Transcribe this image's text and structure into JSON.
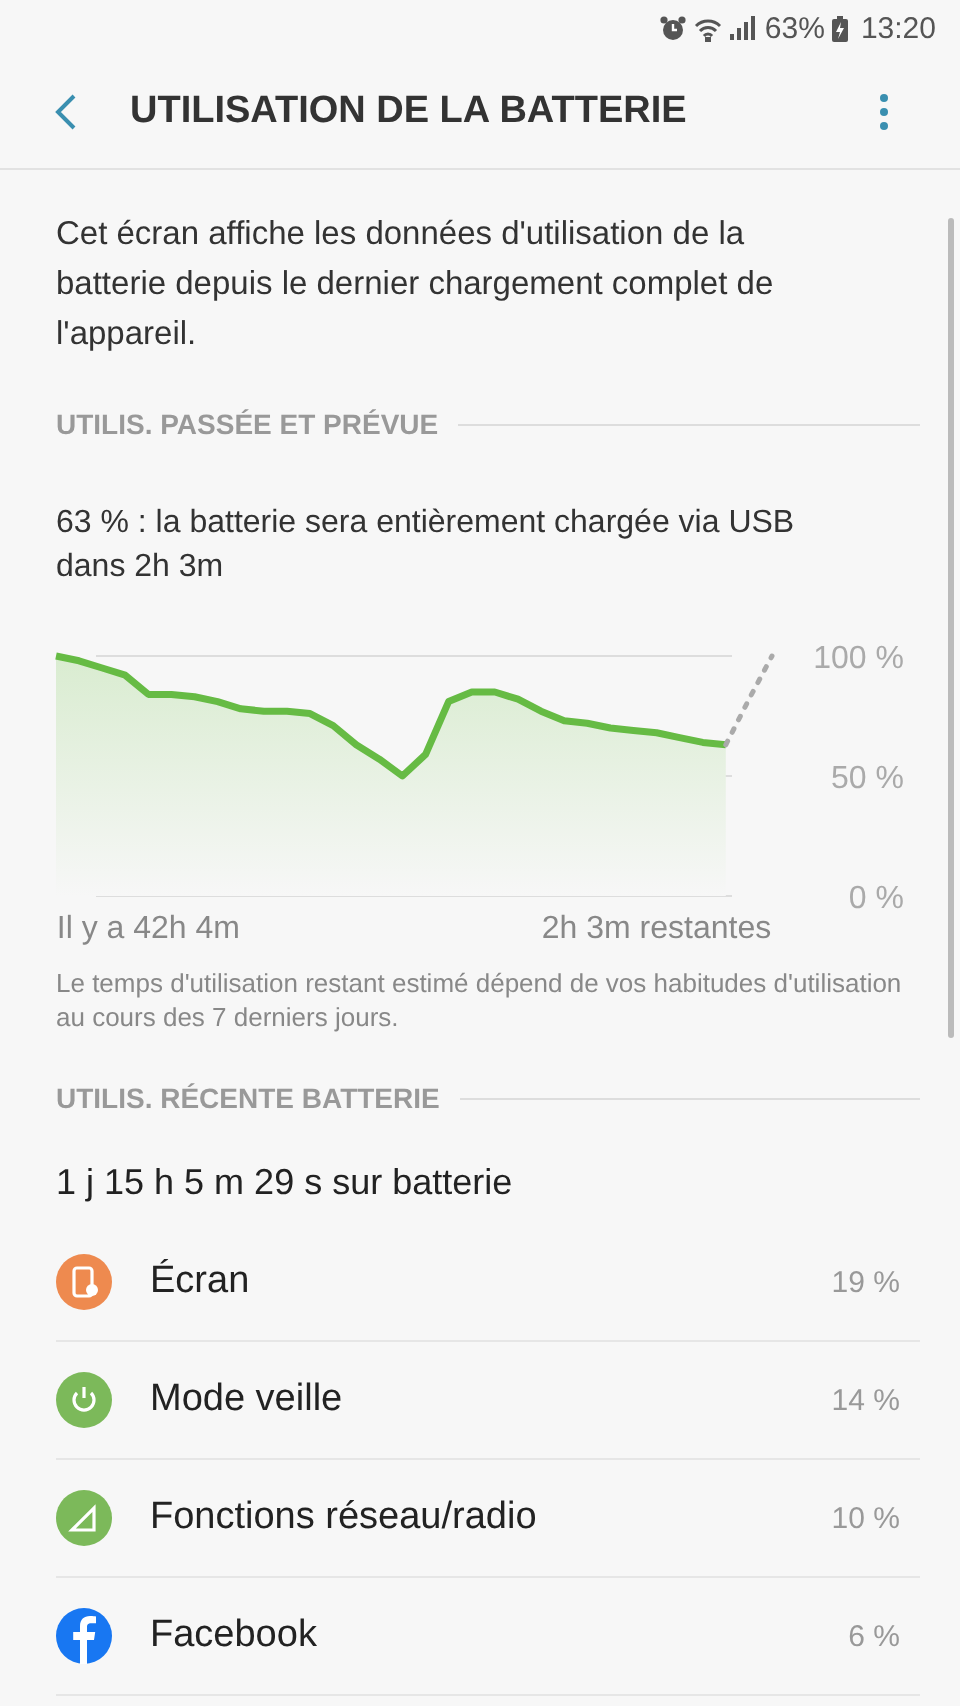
{
  "status_bar": {
    "battery": "63%",
    "time": "13:20"
  },
  "header": {
    "title": "UTILISATION DE LA BATTERIE"
  },
  "intro": "Cet écran affiche les données d'utilisation de la batterie depuis le dernier chargement complet de l'appareil.",
  "past_and_forecast": {
    "heading": "UTILIS. PASSÉE ET PRÉVUE",
    "status": "63 % : la batterie sera entièrement chargée via USB dans 2h 3m",
    "chart_data": {
      "type": "area",
      "categories": [
        null,
        null,
        null,
        null,
        "Il y a 42h 4m",
        null,
        null,
        null,
        null,
        null,
        null,
        null,
        null,
        null,
        null,
        null,
        null,
        null,
        null,
        null,
        null,
        null,
        null,
        null,
        null,
        null,
        "2h 3m restantes",
        null,
        null,
        null,
        null,
        null
      ],
      "ylim": [
        0,
        100
      ],
      "yticks": [
        {
          "value": 0,
          "label": "0 %"
        },
        {
          "value": 50,
          "label": "50 %"
        },
        {
          "value": 100,
          "label": "100 %"
        }
      ],
      "series": [
        {
          "color": "#66bb44",
          "values": [
            100,
            98,
            95,
            92,
            84,
            84,
            83,
            81,
            78,
            77,
            77,
            76,
            71,
            63,
            57,
            50,
            59,
            81,
            85,
            85,
            82,
            77,
            73,
            72,
            70,
            69,
            68,
            66,
            64,
            63,
            null,
            null
          ]
        },
        {
          "type": "line",
          "line_style": "dotted",
          "color": "#aaaaaa",
          "values": [
            null,
            null,
            null,
            null,
            null,
            null,
            null,
            null,
            null,
            null,
            null,
            null,
            null,
            null,
            null,
            null,
            null,
            null,
            null,
            null,
            null,
            null,
            null,
            null,
            null,
            null,
            null,
            null,
            null,
            63,
            82,
            100
          ]
        }
      ]
    },
    "note": "Le temps d'utilisation restant estimé dépend de vos habitudes d'utilisation au cours des 7 derniers jours."
  },
  "recent": {
    "heading": "UTILIS. RÉCENTE BATTERIE",
    "duration": "1 j 15 h 5 m 29 s sur batterie",
    "items": [
      {
        "kind": "screen",
        "label": "Écran",
        "percent": "19 %",
        "color": "#ee8a4f"
      },
      {
        "kind": "standby",
        "label": "Mode veille",
        "percent": "14 %",
        "color": "#7cb95a"
      },
      {
        "kind": "network",
        "label": "Fonctions réseau/radio",
        "percent": "10 %",
        "color": "#7cb95a"
      },
      {
        "kind": "app",
        "label": "Facebook",
        "percent": "6 %",
        "color": "#1877f2"
      }
    ]
  }
}
